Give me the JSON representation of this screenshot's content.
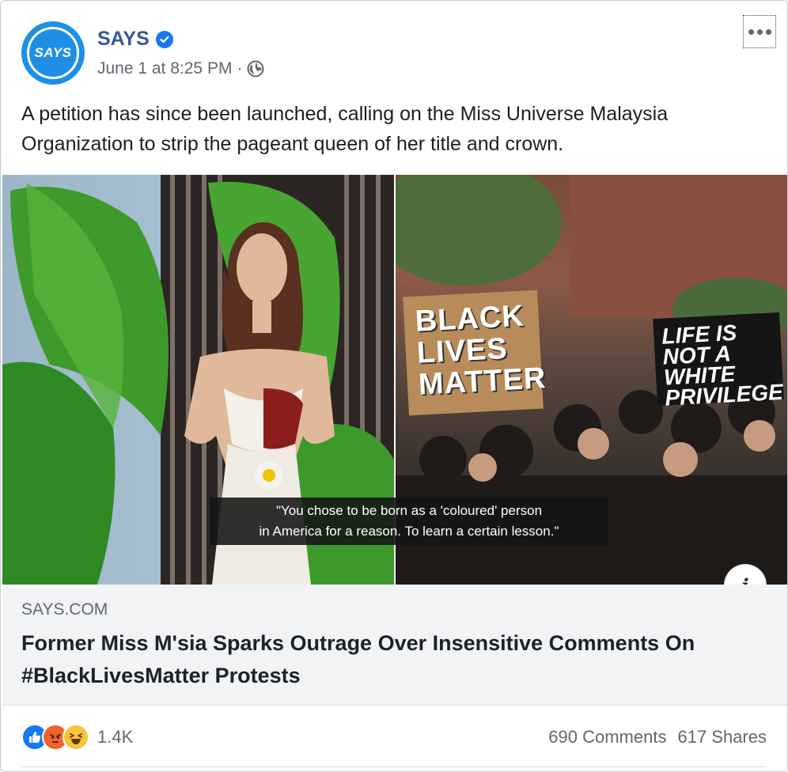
{
  "post": {
    "page_name": "SAYS",
    "avatar_text": "SAYS",
    "timestamp": "June 1 at 8:25 PM",
    "separator": "·",
    "privacy_icon": "globe-icon",
    "more_icon": "more-dots-icon",
    "text": "A petition has since been launched, calling on the Miss Universe Malaysia Organization to strip the pageant queen of her title and crown."
  },
  "image": {
    "caption_line1": "\"You chose to be born as a 'coloured' person",
    "caption_line2": "in America for a reason. To learn a certain lesson.\"",
    "sign_blm": "BLACK LIVES MATTER",
    "sign_life": "LIFE IS NOT A WHITE PRIVILEGE",
    "info_label": "i"
  },
  "link": {
    "domain": "SAYS.COM",
    "title": "Former Miss M'sia Sparks Outrage Over Insensitive Comments On #BlackLivesMatter Protests"
  },
  "footer": {
    "reactions": [
      "like-reaction-icon",
      "angry-reaction-icon",
      "haha-reaction-icon"
    ],
    "reaction_count": "1.4K",
    "comments": "690 Comments",
    "shares": "617 Shares"
  },
  "colors": {
    "brand_blue": "#1f8fe6",
    "link_blue": "#385898",
    "secondary_text": "#606770"
  }
}
